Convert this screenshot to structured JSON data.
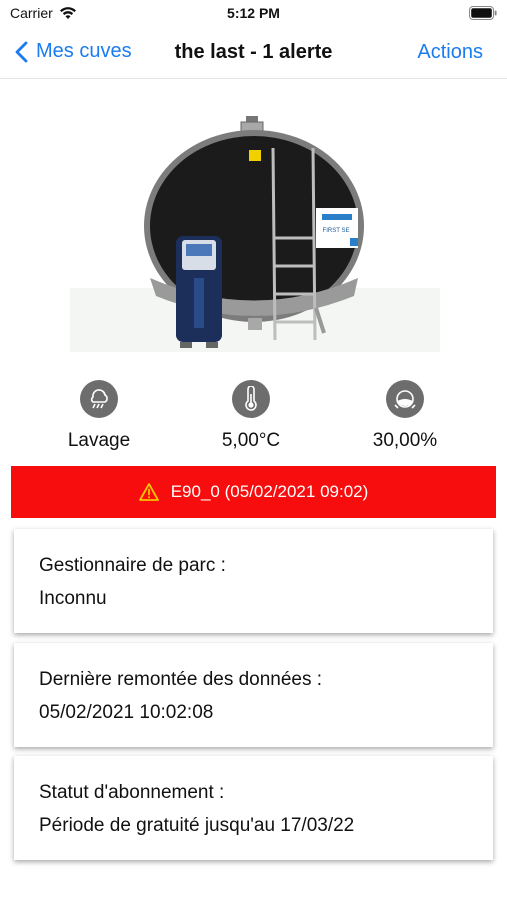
{
  "status_bar": {
    "carrier": "Carrier",
    "time": "5:12 PM"
  },
  "nav": {
    "back_label": "Mes cuves",
    "title": "the last - 1 alerte",
    "actions_label": "Actions"
  },
  "tank": {
    "brand_plate": "FIRST SE"
  },
  "metrics": [
    {
      "icon": "washing-icon",
      "label": "Lavage"
    },
    {
      "icon": "thermometer-icon",
      "label": "5,00°C"
    },
    {
      "icon": "fill-level-icon",
      "label": "30,00%"
    }
  ],
  "alert": {
    "text": "E90_0 (05/02/2021 09:02)",
    "color": "#f70d0d"
  },
  "cards": [
    {
      "label": "Gestionnaire de parc :",
      "value": "Inconnu"
    },
    {
      "label": "Dernière remontée des données :",
      "value": "05/02/2021 10:02:08"
    },
    {
      "label": "Statut d'abonnement :",
      "value": "Période de gratuité jusqu'au 17/03/22"
    }
  ],
  "accent_color": "#1a7cf0"
}
